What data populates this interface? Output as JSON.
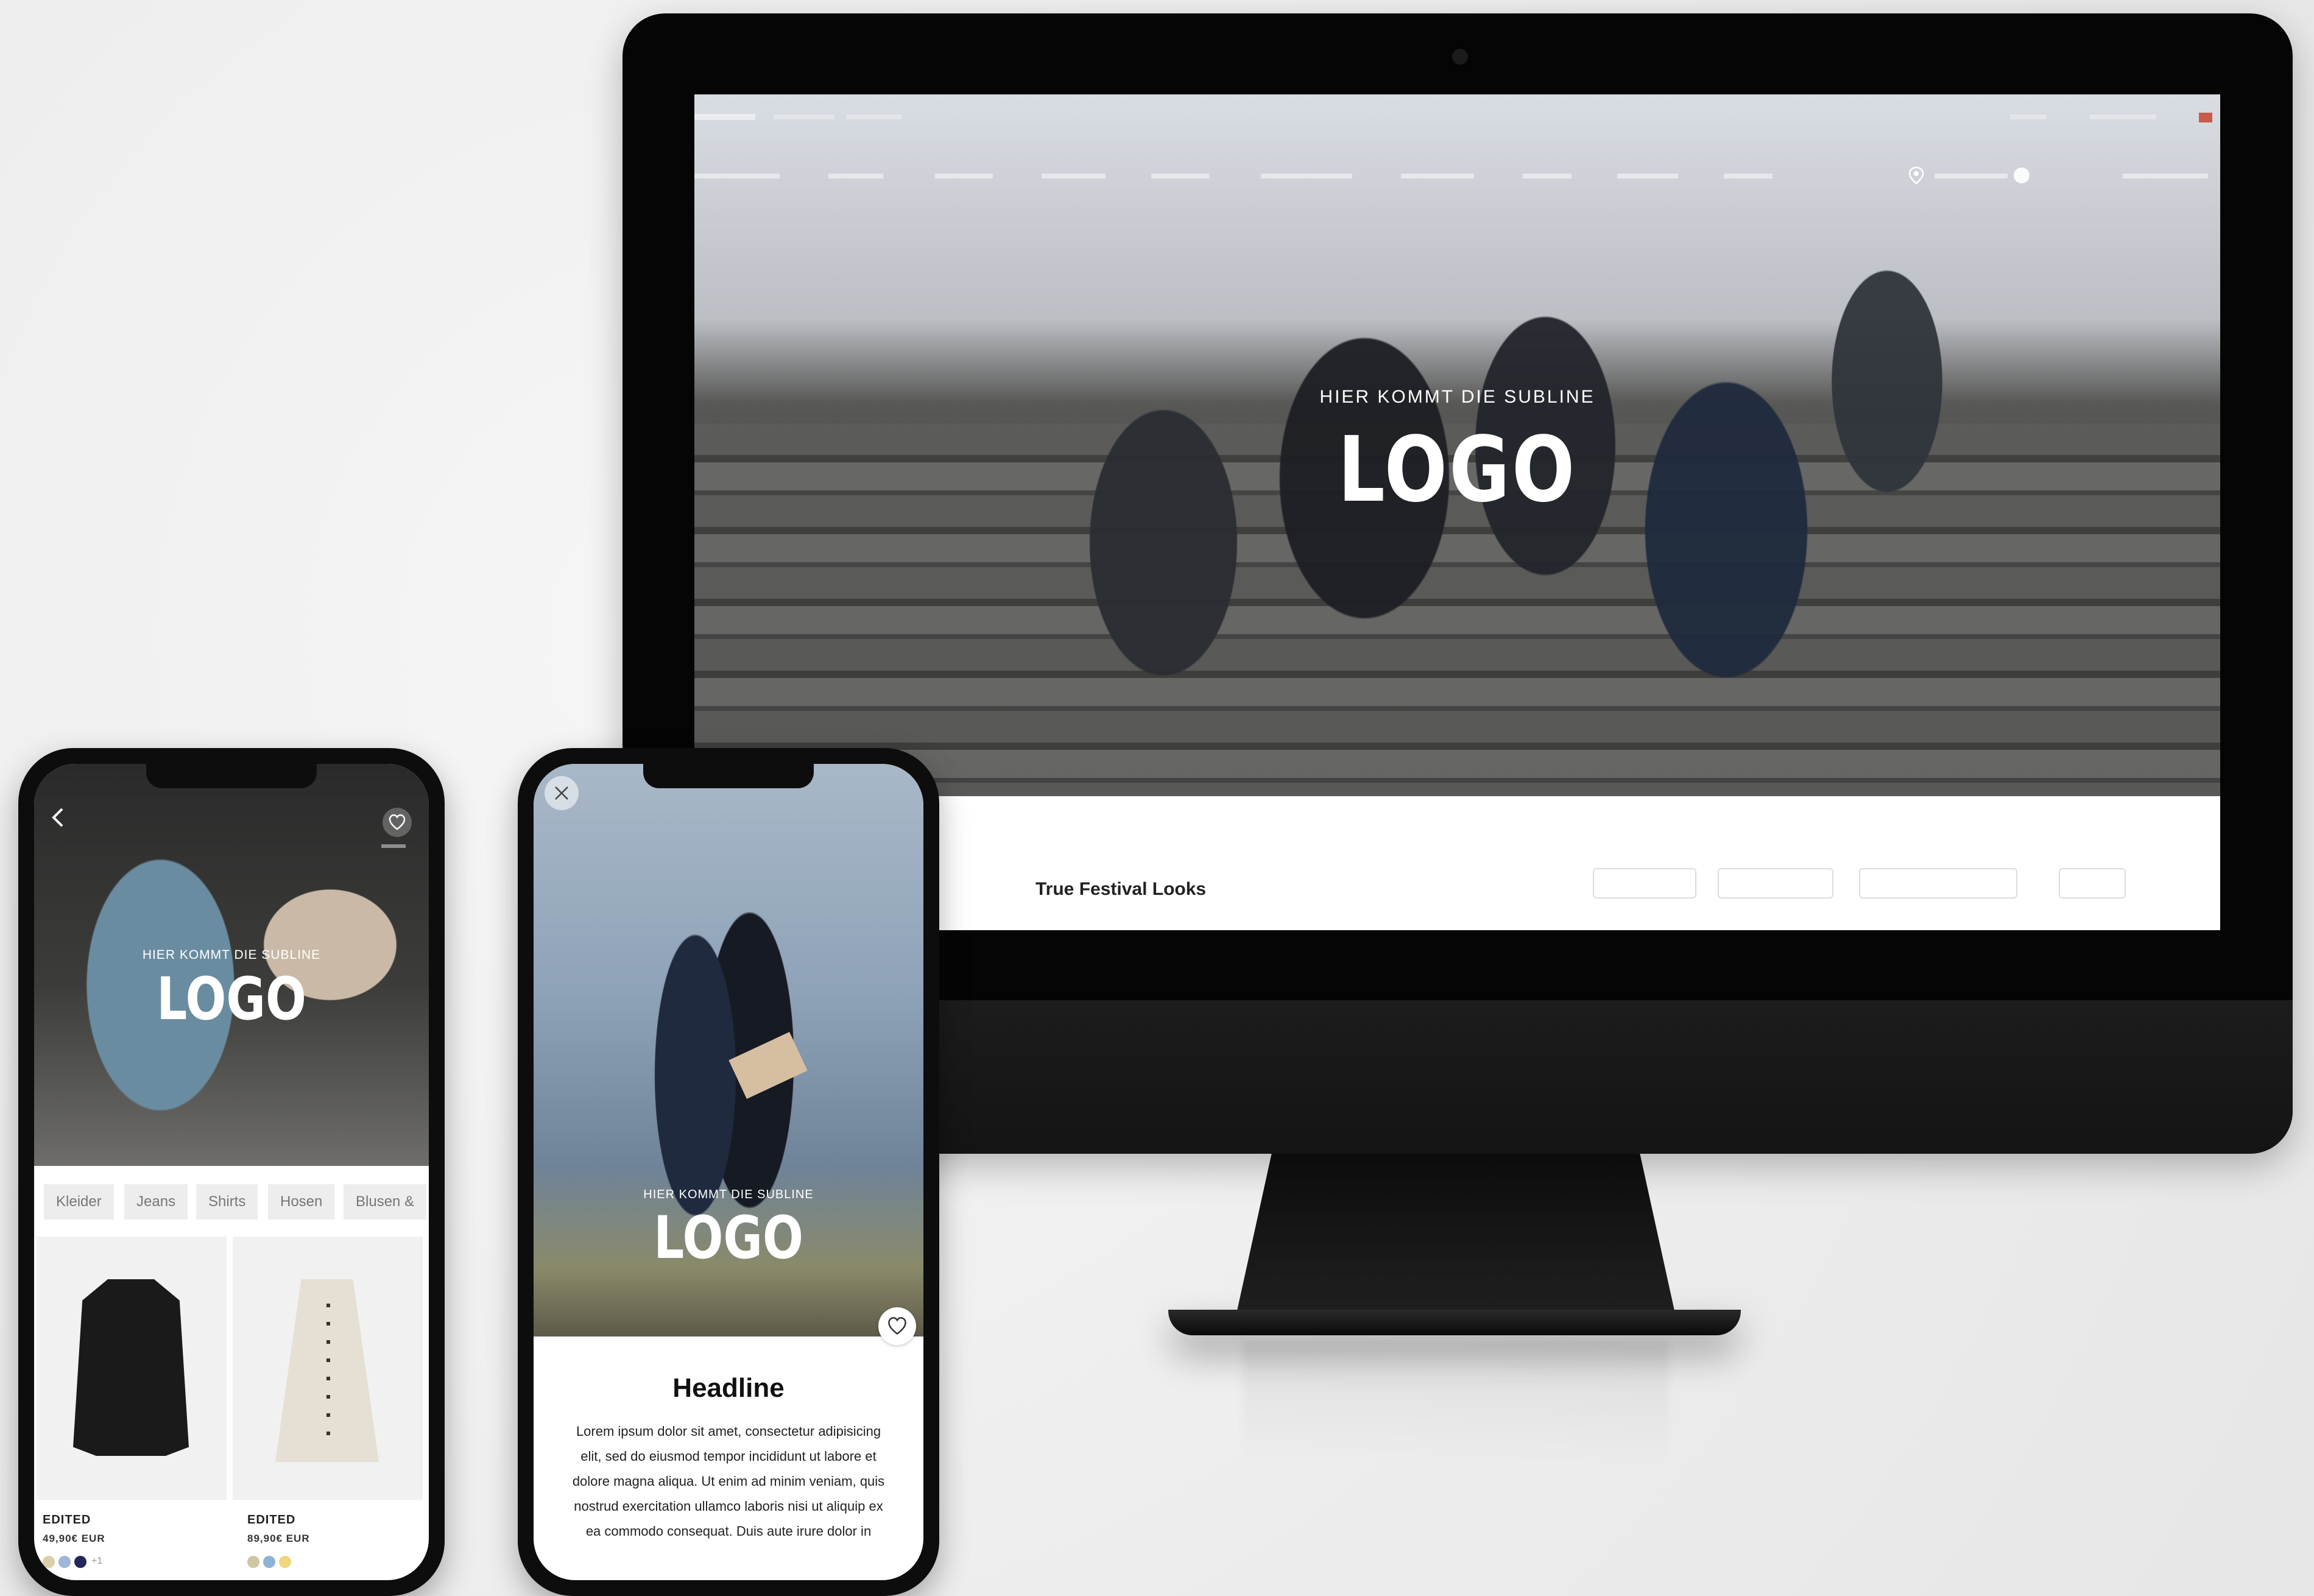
{
  "desktop": {
    "top_links": [
      "",
      ""
    ],
    "nav_items": [
      "",
      "",
      "",
      "",
      "",
      "",
      "",
      "",
      "",
      ""
    ],
    "hero_subline": "HIER KOMMT DIE SUBLINE",
    "hero_logo": "LOGO",
    "page_heading": "True Festival Looks",
    "filters": [
      "",
      "",
      "",
      ""
    ]
  },
  "phone_listing": {
    "hero_subline": "HIER KOMMT DIE SUBLINE",
    "hero_logo": "LOGO",
    "categories": [
      "Kleider",
      "Jeans",
      "Shirts",
      "Hosen",
      "Blusen &"
    ],
    "products": [
      {
        "brand": "EDITED",
        "price": "49,90€ EUR",
        "swatch_colors": [
          "#d9cfa8",
          "#9fb6d6",
          "#23275a"
        ],
        "more": "+1"
      },
      {
        "brand": "EDITED",
        "price": "89,90€ EUR",
        "swatch_colors": [
          "#cfc6a2",
          "#8fb1d8",
          "#efd77e"
        ]
      }
    ]
  },
  "phone_detail": {
    "hero_subline": "HIER KOMMT DIE SUBLINE",
    "hero_logo": "LOGO",
    "headline": "Headline",
    "body_lines": [
      "Lorem ipsum dolor sit amet, consectetur adipisicing",
      "elit, sed do eiusmod tempor incididunt ut labore et",
      "dolore magna aliqua. Ut enim ad minim veniam, quis",
      "nostrud exercitation ullamco laboris nisi ut aliquip ex",
      "ea commodo consequat. Duis aute irure dolor in"
    ]
  },
  "icons": {
    "back": "chevron-left-icon",
    "heart": "heart-icon",
    "close": "close-icon",
    "location": "location-pin-icon"
  },
  "colors": {
    "device_frame": "#0d0d0d",
    "background": "#efefef",
    "text_dark": "#111111"
  }
}
